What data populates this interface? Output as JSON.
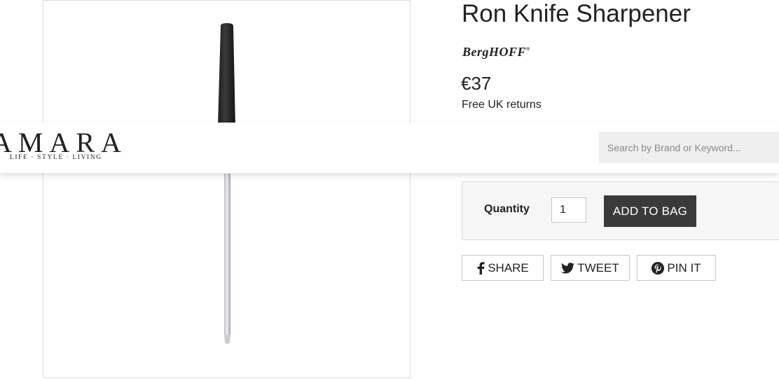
{
  "product": {
    "title": "Ron Knife Sharpener",
    "brand": "BergHOFF",
    "brand_mark": "®",
    "price": "€37",
    "returns": "Free UK returns"
  },
  "header": {
    "logo": "AMARA",
    "tagline": "LIFE · STYLE · LIVING",
    "search_placeholder": "Search by Brand or Keyword..."
  },
  "purchase": {
    "quantity_label": "Quantity",
    "quantity_value": "1",
    "add_to_bag_label": "ADD TO BAG"
  },
  "social": {
    "share_label": "SHARE",
    "tweet_label": "TWEET",
    "pin_label": "PIN IT"
  },
  "icons": {
    "share": "facebook-icon",
    "tweet": "twitter-icon",
    "pin": "pinterest-icon"
  },
  "colors": {
    "button_dark": "#3a3a3a",
    "panel_bg": "#f6f6f6",
    "search_bg": "#efefef"
  }
}
